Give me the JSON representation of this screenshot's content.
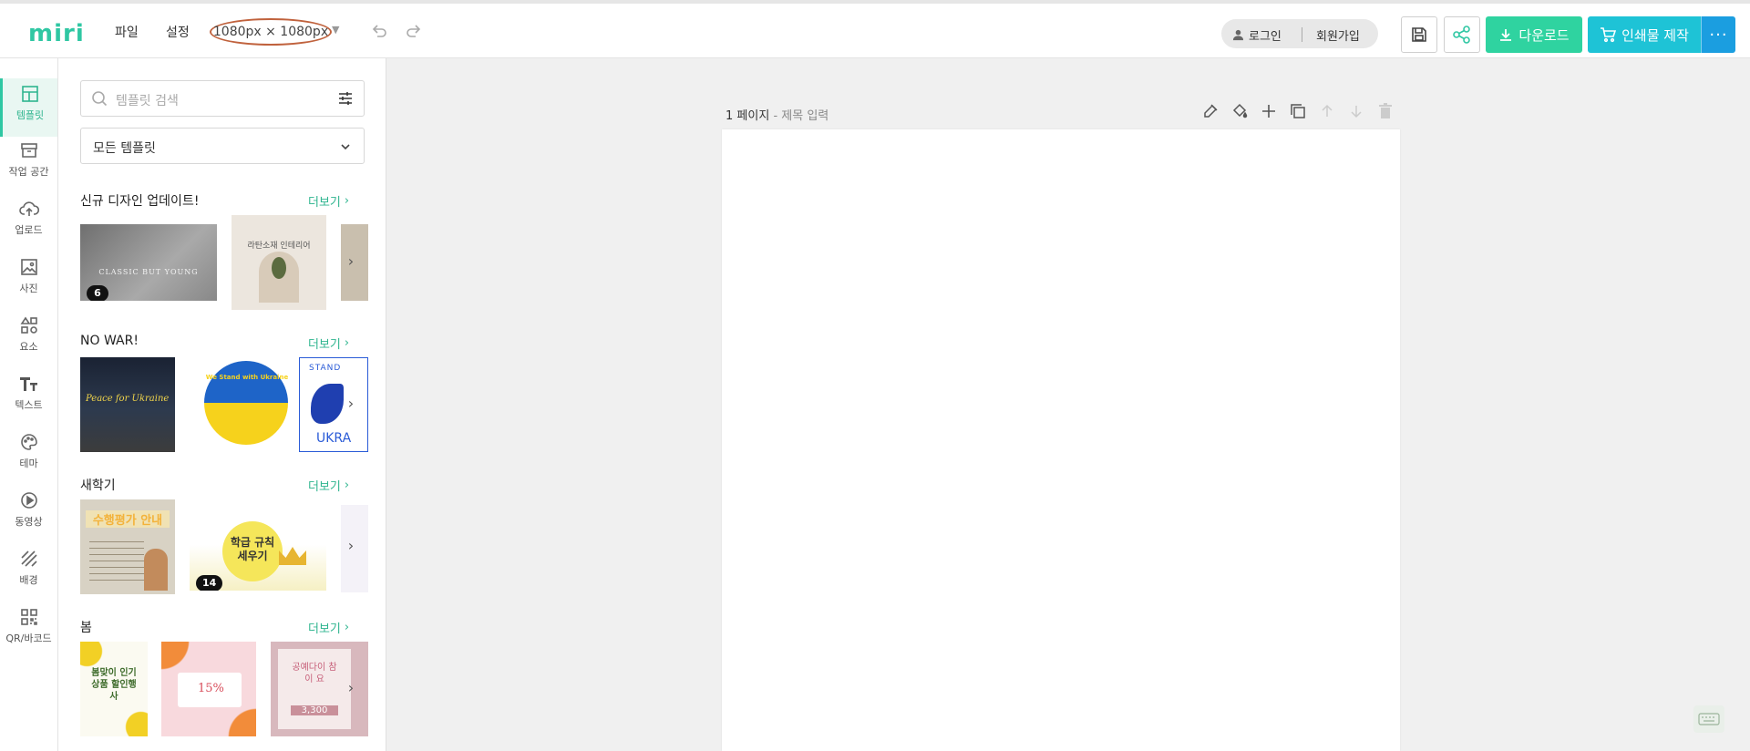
{
  "app": {
    "logo": "miri"
  },
  "header": {
    "menu_file": "파일",
    "menu_settings": "설정",
    "canvas_size": "1080px × 1080px",
    "login": "로그인",
    "signup": "회원가입",
    "download": "다운로드",
    "print": "인쇄물 제작",
    "more": "···"
  },
  "sidebar": {
    "items": [
      {
        "label": "템플릿",
        "icon": "layout-icon"
      },
      {
        "label": "작업 공간",
        "icon": "archive-icon"
      },
      {
        "label": "업로드",
        "icon": "cloud-upload-icon"
      },
      {
        "label": "사진",
        "icon": "image-icon"
      },
      {
        "label": "요소",
        "icon": "shapes-icon"
      },
      {
        "label": "텍스트",
        "icon": "text-icon"
      },
      {
        "label": "테마",
        "icon": "palette-icon"
      },
      {
        "label": "동영상",
        "icon": "play-icon"
      },
      {
        "label": "배경",
        "icon": "stripes-icon"
      },
      {
        "label": "QR/바코드",
        "icon": "qr-icon"
      }
    ]
  },
  "panel": {
    "search_placeholder": "템플릿 검색",
    "filter": "모든 템플릿",
    "see_more": "더보기",
    "sections": [
      {
        "title": "신규 디자인 업데이트!",
        "badge": "6",
        "thumb_texts": [
          "CLASSIC BUT YOUNG",
          "라탄소재 인테리어"
        ]
      },
      {
        "title": "NO WAR!",
        "thumb_texts": [
          "Peace for Ukraine",
          "We Stand with Ukraine",
          "STAND",
          "UKRA"
        ]
      },
      {
        "title": "새학기",
        "badge": "14",
        "thumb_texts": [
          "수행평가 안내",
          "학급 규칙 세우기"
        ]
      },
      {
        "title": "봄",
        "thumb_texts": [
          "봄맞이 인기상품 할인행사",
          "15%",
          "공예다이 참이 요",
          "3,300"
        ]
      }
    ]
  },
  "canvas": {
    "page_number": "1 페이지",
    "page_title_placeholder": "- 제목 입력"
  },
  "colors": {
    "brand": "#2fc7a3",
    "download": "#2fd3a0",
    "print": "#1ec3d6",
    "more": "#1b9ee0"
  }
}
